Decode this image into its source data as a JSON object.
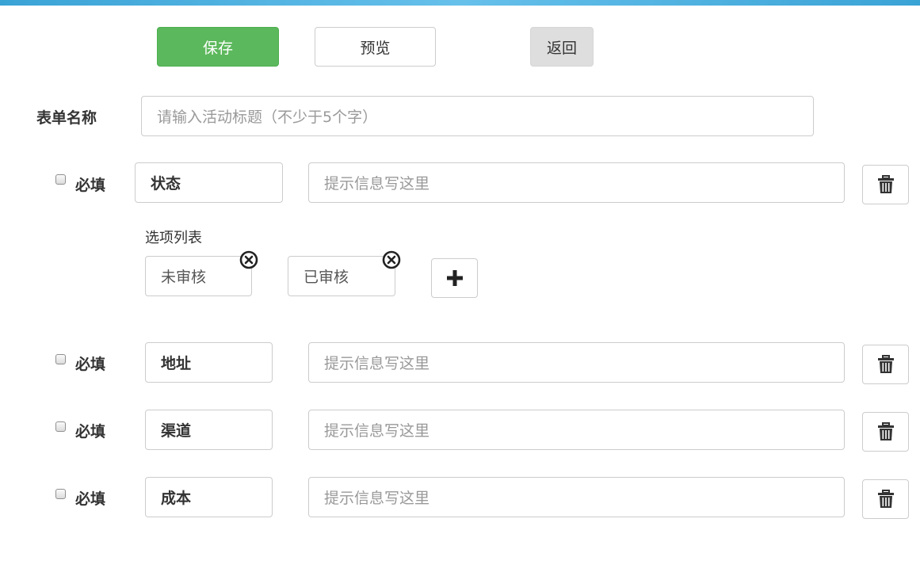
{
  "toolbar": {
    "save_label": "保存",
    "preview_label": "预览",
    "back_label": "返回"
  },
  "form": {
    "name_label": "表单名称",
    "name_placeholder": "请输入活动标题（不少于5个字）"
  },
  "fields": [
    {
      "required_label": "必填",
      "required_checked": false,
      "name": "状态",
      "hint_placeholder": "提示信息写这里",
      "options_title": "选项列表",
      "options": [
        "未审核",
        "已审核"
      ]
    },
    {
      "required_label": "必填",
      "required_checked": false,
      "name": "地址",
      "hint_placeholder": "提示信息写这里"
    },
    {
      "required_label": "必填",
      "required_checked": false,
      "name": "渠道",
      "hint_placeholder": "提示信息写这里"
    },
    {
      "required_label": "必填",
      "required_checked": false,
      "name": "成本",
      "hint_placeholder": "提示信息写这里"
    }
  ],
  "icons": {
    "delete": "trash-icon",
    "remove_option": "close-circle-icon",
    "add_option": "plus-icon"
  },
  "colors": {
    "save_bg": "#5cb85c",
    "back_bg": "#dedede",
    "placeholder": "#999999"
  }
}
